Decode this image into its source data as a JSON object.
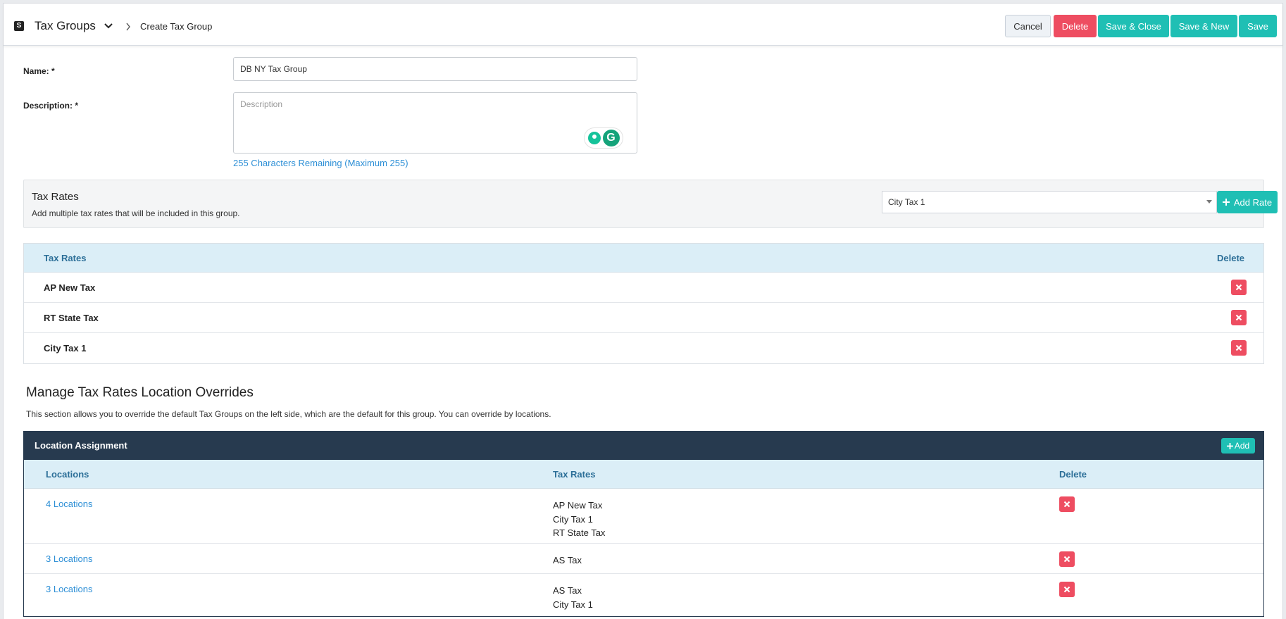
{
  "header": {
    "logo_letter": "S",
    "module_title": "Tax Groups",
    "breadcrumb": "Create Tax Group",
    "buttons": {
      "cancel": "Cancel",
      "delete": "Delete",
      "save_close": "Save & Close",
      "save_new": "Save & New",
      "save": "Save"
    }
  },
  "form": {
    "name_label": "Name: *",
    "name_value": "DB NY Tax Group",
    "description_label": "Description: *",
    "description_placeholder": "Description",
    "chars_remaining": "255 Characters Remaining (Maximum 255)"
  },
  "tax_rates_panel": {
    "title": "Tax Rates",
    "subtitle": "Add multiple tax rates that will be included in this group.",
    "selected_rate": "City Tax 1",
    "add_rate_label": "Add Rate"
  },
  "tax_rates_table": {
    "col_rates": "Tax Rates",
    "col_delete": "Delete",
    "rows": [
      {
        "name": "AP New Tax"
      },
      {
        "name": "RT State Tax"
      },
      {
        "name": "City Tax 1"
      }
    ]
  },
  "overrides": {
    "title": "Manage Tax Rates Location Overrides",
    "subtitle": "This section allows you to override the default Tax Groups on the left side, which are the default for this group. You can override by locations.",
    "bar_title": "Location Assignment",
    "add_label": "Add",
    "col_locations": "Locations",
    "col_rates": "Tax Rates",
    "col_delete": "Delete",
    "rows": [
      {
        "locations": "4 Locations",
        "rates": [
          "AP New Tax",
          "City Tax 1",
          "RT State Tax"
        ]
      },
      {
        "locations": "3 Locations",
        "rates": [
          "AS Tax"
        ]
      },
      {
        "locations": "3 Locations",
        "rates": [
          "AS Tax",
          "City Tax 1"
        ]
      }
    ]
  },
  "colors": {
    "teal": "#1fbfb4",
    "danger": "#ee4d61",
    "header_blue": "#dbeef7",
    "dark_bar": "#273a4f",
    "link": "#2d8fd6"
  }
}
